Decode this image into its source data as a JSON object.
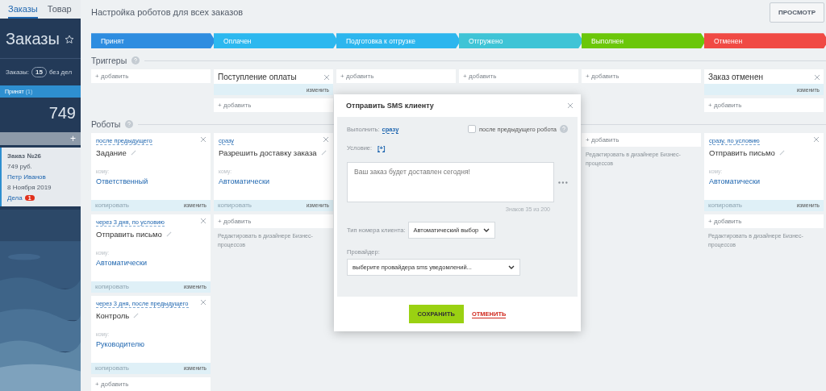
{
  "top_tabs": [
    {
      "label": "Заказы",
      "selected": true
    },
    {
      "label": "Товар",
      "selected": false
    }
  ],
  "sidebar": {
    "title": "Заказы",
    "counter_label": "Заказы:",
    "counter": "15",
    "counter_suffix": "без дел",
    "stage_name": "Принят",
    "stage_count": "(1)",
    "total": "749",
    "add": "+",
    "deal": {
      "title": "Заказ №26",
      "price": "749 руб.",
      "contact": "Петр Иванов",
      "date": "8 Ноября 2019",
      "tasks_label": "Дела",
      "tasks_count": "1"
    }
  },
  "header": {
    "title": "Настройка роботов для всех заказов",
    "preview_button": "ПРОСМОТР"
  },
  "stages": [
    {
      "name": "Принят",
      "color": "#2e8de0"
    },
    {
      "name": "Оплачен",
      "color": "#2cb8ef"
    },
    {
      "name": "Подготовка к отгрузке",
      "color": "#2cb6ee"
    },
    {
      "name": "Отгружено",
      "color": "#3fc4d6"
    },
    {
      "name": "Выполнен",
      "color": "#6bc70a"
    },
    {
      "name": "Отменен",
      "color": "#f04a44"
    }
  ],
  "triggers": {
    "title": "Триггеры",
    "columns": [
      {
        "add": "+ добавить"
      },
      {
        "cards": [
          {
            "title": "Поступление оплаты",
            "edit": "изменить"
          }
        ],
        "add": "+ добавить"
      },
      {
        "add": "+ добавить"
      },
      {
        "add": "+ добавить"
      },
      {
        "add": "+ добавить"
      },
      {
        "cards": [
          {
            "title": "Заказ отменен",
            "edit": "изменить"
          }
        ],
        "add": "+ добавить"
      }
    ]
  },
  "robots": {
    "title": "Роботы",
    "columns": [
      {
        "cards": [
          {
            "timing": "после предыдущего",
            "title": "Задание",
            "to_label": "кому:",
            "to": "Ответственный",
            "copy": "копировать",
            "edit": "изменить"
          },
          {
            "timing": "через 3 дня, по условию",
            "title": "Отправить письмо",
            "to_label": "кому:",
            "to": "Автоматически",
            "copy": "копировать",
            "edit": "изменить"
          },
          {
            "timing": "через 3 дня, после предыдущего",
            "title": "Контроль",
            "to_label": "кому:",
            "to": "Руководителю",
            "copy": "копировать",
            "edit": "изменить"
          }
        ],
        "add": "+ добавить"
      },
      {
        "cards": [
          {
            "timing": "сразу",
            "title": "Разрешить доставку заказа",
            "to_label": "кому:",
            "to": "Автоматически",
            "copy": "копировать",
            "edit": "изменить"
          }
        ],
        "add": "+ добавить",
        "designer_link": "Редактировать в дизайнере Бизнес-процессов"
      },
      {},
      {},
      {
        "add": "+ добавить",
        "designer_link": "Редактировать в дизайнере Бизнес-процессов"
      },
      {
        "cards": [
          {
            "timing": "сразу, по условию",
            "title": "Отправить письмо",
            "to_label": "кому:",
            "to": "Автоматически",
            "copy": "копировать",
            "edit": "изменить"
          }
        ],
        "add": "+ добавить",
        "designer_link": "Редактировать в дизайнере Бизнес-процессов"
      }
    ]
  },
  "dialog": {
    "title": "Отправить SMS клиенту",
    "run_label": "Выполнить:",
    "run_value": "сразу",
    "after_previous": {
      "label": "после предыдущего робота",
      "checked": false
    },
    "condition_label": "Условие:",
    "condition_add": "[+]",
    "message": "Ваш заказ будет доставлен сегодня!",
    "char_count": "Знаков 35 из 200",
    "phone_type_label": "Тип номера клиента:",
    "phone_type": "Автоматический выбор",
    "provider_label": "Провайдер:",
    "provider": "выберите провайдера sms уведомлений...",
    "save": "СОХРАНИТЬ",
    "cancel": "ОТМЕНИТЬ"
  }
}
